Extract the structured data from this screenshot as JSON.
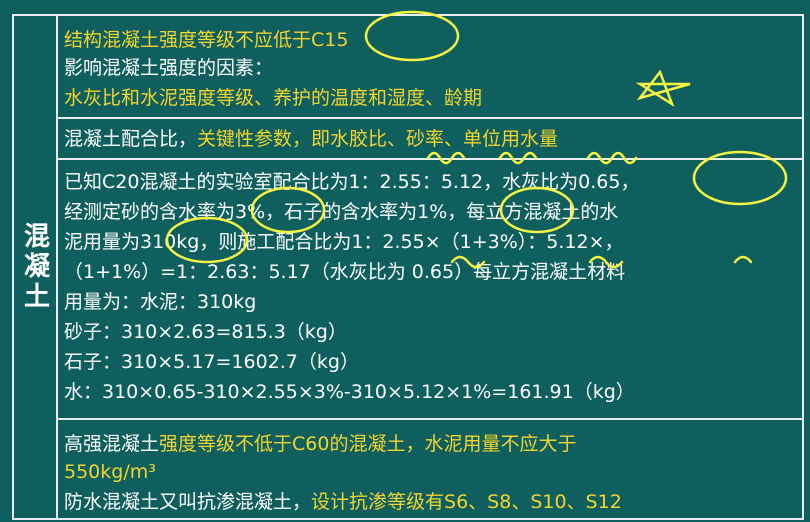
{
  "left_label": "混凝土",
  "sec1": {
    "line1": "结构混凝土强度等级不应低于C15",
    "line2": "影响混凝土强度的因素：",
    "line3": "水灰比和水泥强度等级、养护的温度和湿度、龄期"
  },
  "sec2": {
    "prefix": "混凝土配合比，",
    "highlight": "关键性参数，即水胶比、砂率、单位用水量"
  },
  "sec3": {
    "l1": "已知C20混凝土的实验室配合比为1：2.55：5.12，水灰比为0.65，",
    "l2": "经测定砂的含水率为3%，石子的含水率为1%，每立方混凝土的水",
    "l3": "泥用量为310kg，则施工配合比为1：2.55×（1+3%）：5.12×，",
    "l4": "（1+1%）=1：2.63：5.17（水灰比为 0.65）每立方混凝土材料",
    "l5": "用量为：水泥：310kg",
    "l6": "砂子：310×2.63=815.3（kg）",
    "l7": "石子：310×5.17=1602.7（kg）",
    "l8": "水：310×0.65-310×2.55×3%-310×5.12×1%=161.91（kg）"
  },
  "sec4": {
    "l1_white": "高强混凝土",
    "l1_yellow": "强度等级不低于C60的混凝土，水泥用量不应大于",
    "l2": "550kg/m³",
    "l3_white": "防水混凝土又叫抗渗混凝土，",
    "l3_yellow": "设计抗渗等级有S6、S8、S10、S12"
  },
  "colors": {
    "background": "#0f5f5e",
    "highlight": "#f2d42e",
    "text": "#ffffff",
    "annotation": "#f5f542"
  }
}
